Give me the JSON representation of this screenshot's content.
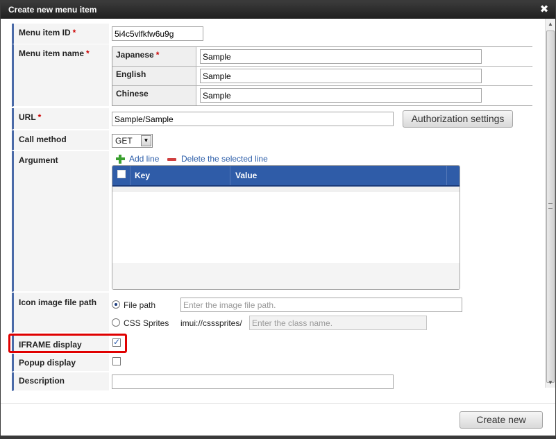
{
  "dialog": {
    "title": "Create new menu item",
    "close_icon": "close-icon"
  },
  "form": {
    "menu_item_id": {
      "label": "Menu item ID",
      "required": "*",
      "value": "5i4c5vlfkfw6u9g"
    },
    "menu_item_name": {
      "label": "Menu item name",
      "required": "*",
      "languages": [
        {
          "name": "Japanese",
          "required": "*",
          "value": "Sample"
        },
        {
          "name": "English",
          "required": "",
          "value": "Sample"
        },
        {
          "name": "Chinese",
          "required": "",
          "value": "Sample"
        }
      ]
    },
    "url": {
      "label": "URL",
      "required": "*",
      "value": "Sample/Sample",
      "auth_button": "Authorization settings"
    },
    "call_method": {
      "label": "Call method",
      "value": "GET"
    },
    "argument": {
      "label": "Argument",
      "add_line": "Add line",
      "delete_line": "Delete the selected line",
      "columns": [
        "Key",
        "Value"
      ],
      "rows": []
    },
    "icon_image": {
      "label": "Icon image file path",
      "option_file": "File path",
      "file_placeholder": "Enter the image file path.",
      "option_css": "CSS Sprites",
      "css_prefix": "imui://csssprites/",
      "css_placeholder": "Enter the class name.",
      "selected": "File path"
    },
    "iframe_display": {
      "label": "IFRAME display",
      "checked": true
    },
    "popup_display": {
      "label": "Popup display",
      "checked": false
    },
    "description": {
      "label": "Description",
      "value": ""
    }
  },
  "footer": {
    "create_button": "Create new"
  },
  "colors": {
    "titlebar": "#2a2a2a",
    "accent": "#2f5ca8",
    "highlight": "#e00000",
    "required": "#cc0000"
  }
}
